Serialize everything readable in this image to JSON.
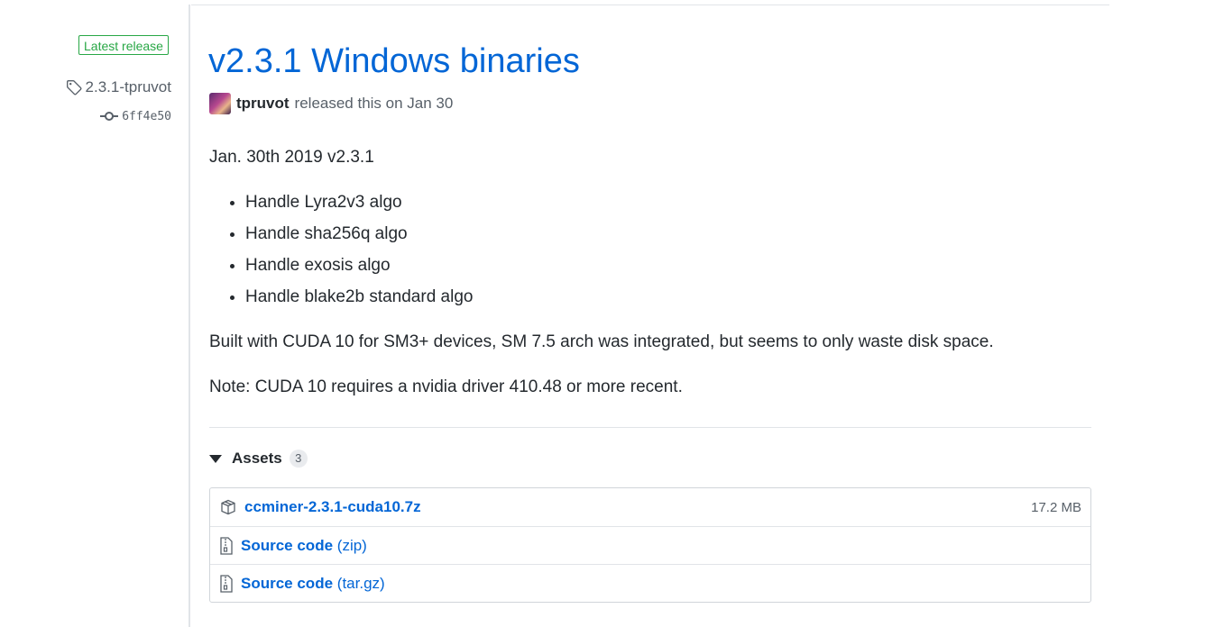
{
  "sidebar": {
    "latest_label": "Latest release",
    "tag": "2.3.1-tpruvot",
    "commit": "6ff4e50",
    "accent_color": "#28a745"
  },
  "release": {
    "title": "v2.3.1 Windows binaries",
    "author": "tpruvot",
    "released_text": "released this on Jan 30",
    "title_color": "#0366d6"
  },
  "notes": {
    "date_line": "Jan. 30th 2019 v2.3.1",
    "items": [
      "Handle Lyra2v3 algo",
      "Handle sha256q algo",
      "Handle exosis algo",
      "Handle blake2b standard algo"
    ],
    "built_line": "Built with CUDA 10 for SM3+ devices, SM 7.5 arch was integrated, but seems to only waste disk space.",
    "note_line": "Note: CUDA 10 requires a nvidia driver 410.48 or more recent."
  },
  "assets": {
    "label": "Assets",
    "count": "3",
    "files": [
      {
        "name": "ccminer-2.3.1-cuda10.7z",
        "size": "17.2 MB",
        "icon": "package-icon"
      },
      {
        "name": "Source code",
        "suffix": "(zip)",
        "icon": "file-zip-icon"
      },
      {
        "name": "Source code",
        "suffix": "(tar.gz)",
        "icon": "file-zip-icon"
      }
    ]
  }
}
